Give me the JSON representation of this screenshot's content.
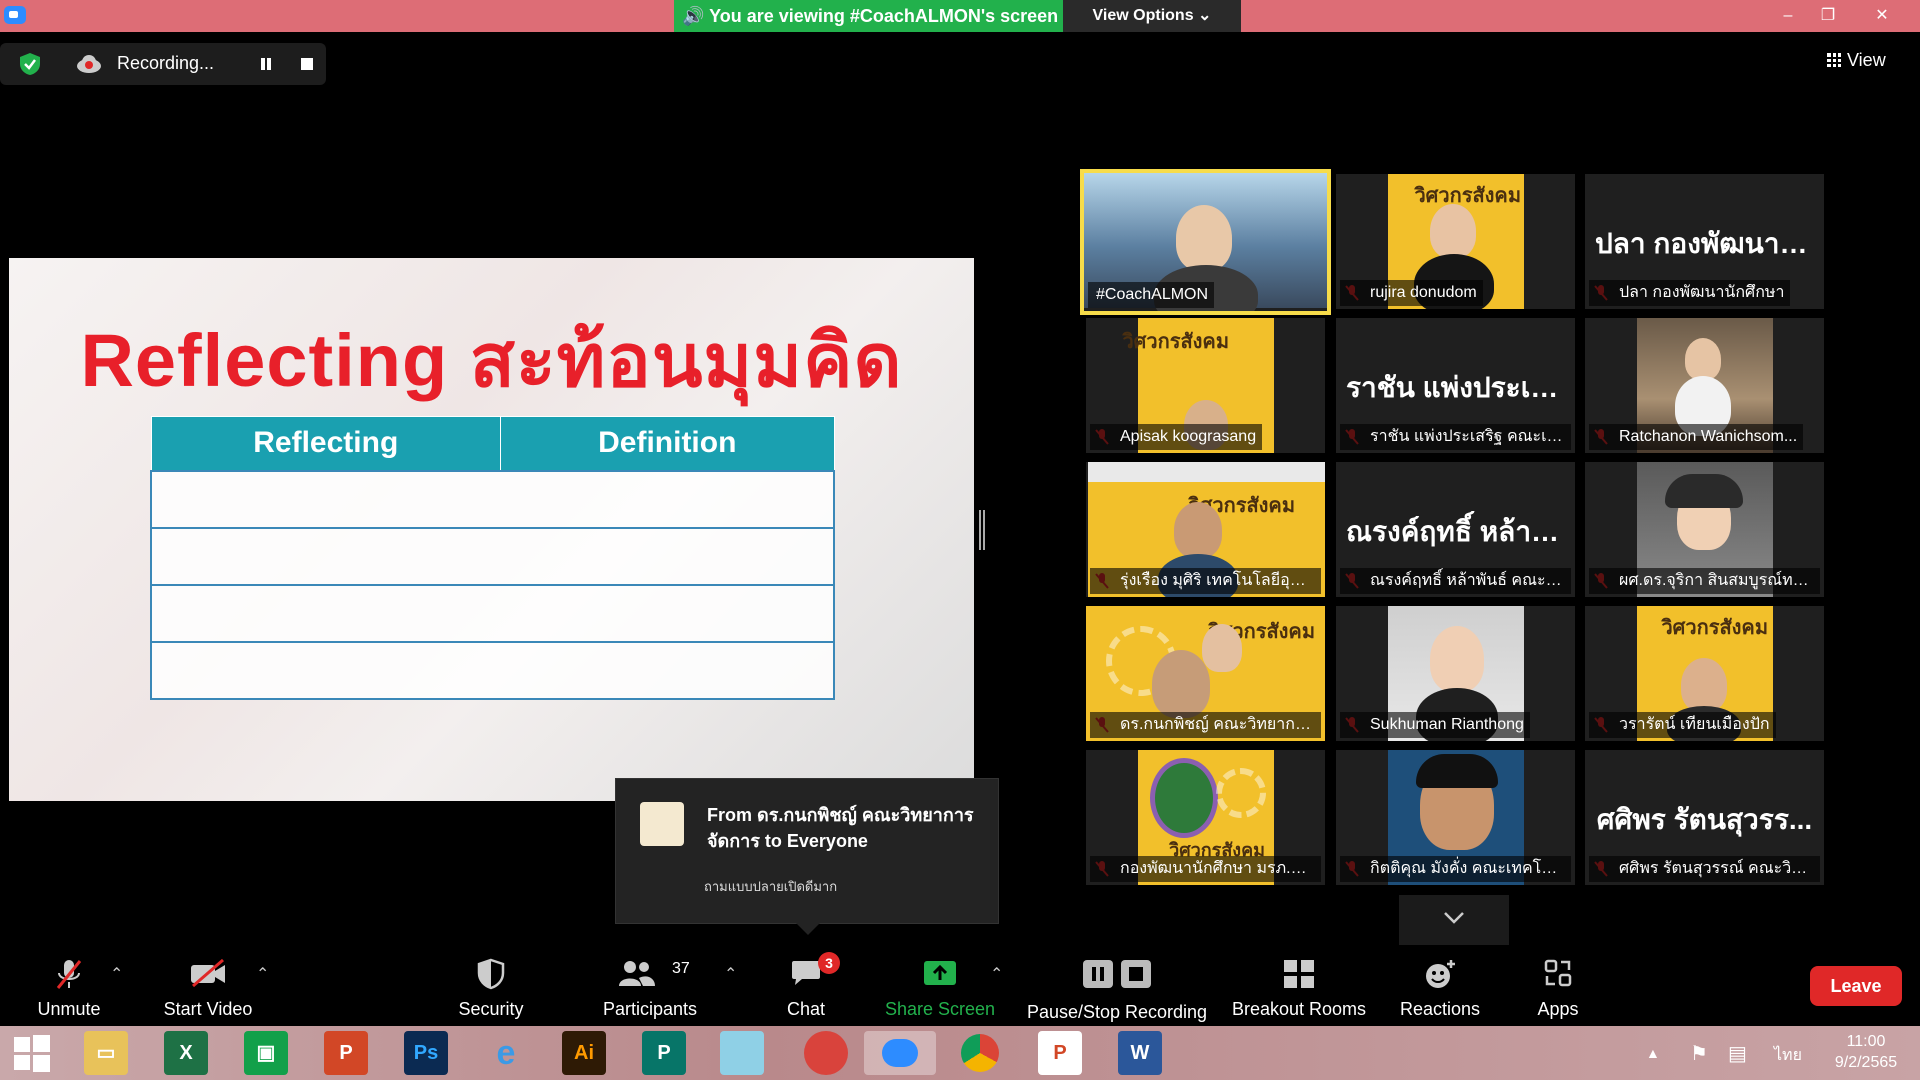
{
  "titlebar": {
    "banner_text": "You are viewing #CoachALMON's screen",
    "view_options": "View Options"
  },
  "recording": {
    "label": "Recording..."
  },
  "view_label": "View",
  "slide": {
    "title": "Reflecting สะท้อนมุมคิด",
    "col1": "Reflecting",
    "col2": "Definition"
  },
  "gallery": [
    {
      "caption": "#CoachALMON",
      "big": ""
    },
    {
      "caption": "rujira donudom",
      "big": ""
    },
    {
      "caption": "ปลา กองพัฒนานักศึกษา",
      "big": "ปลา กองพัฒนานั..."
    },
    {
      "caption": "Apisak koograsang",
      "big": ""
    },
    {
      "caption": "ราชัน แพ่งประเสริฐ คณะเทค...",
      "big": "ราชัน แพ่งประเส..."
    },
    {
      "caption": "Ratchanon Wanichsom...",
      "big": ""
    },
    {
      "caption": "รุ่งเรือง มุศิริ เทคโนโลยีอุตสา...",
      "big": ""
    },
    {
      "caption": "ณรงค์ฤทธิ์ หล้าพันธ์ คณะวิทย์",
      "big": "ณรงค์ฤทธิ์ หล้าพั..."
    },
    {
      "caption": "ผศ.ดร.จุริกา สินสมบูรณ์ทอง...",
      "big": ""
    },
    {
      "caption": "ดร.กนกพิชญ์ คณะวิทยาการ...",
      "big": ""
    },
    {
      "caption": "Sukhuman Rianthong",
      "big": ""
    },
    {
      "caption": "วรารัตน์ เทียนเมืองปัก",
      "big": ""
    },
    {
      "caption": "กองพัฒนานักศึกษา มรภ.พร...",
      "big": ""
    },
    {
      "caption": "กิตติคุณ มังคั่ง คณะเทคโนโล...",
      "big": ""
    },
    {
      "caption": "ศศิพร รัตนสุวรรณ์ คณะวิทย...",
      "big": "ศศิพร รัตนสุวรร..."
    }
  ],
  "tile_brand": "วิศวกรสังคม",
  "chat": {
    "from": "From ดร.กนกพิชญ์ คณะวิทยาการจัดการ to Everyone",
    "message": "ถามแบบปลายเปิดดีมาก"
  },
  "toolbar": {
    "unmute": "Unmute",
    "start_video": "Start Video",
    "security": "Security",
    "participants": "Participants",
    "participants_count": "37",
    "chat": "Chat",
    "chat_badge": "3",
    "share": "Share Screen",
    "pause_stop": "Pause/Stop Recording",
    "breakout": "Breakout Rooms",
    "reactions": "Reactions",
    "apps": "Apps",
    "leave": "Leave"
  },
  "taskbar": {
    "apps": [
      "windows-start",
      "file-explorer",
      "excel",
      "store",
      "powerpoint",
      "photoshop",
      "internet-explorer",
      "illustrator",
      "publisher",
      "notepad",
      "fotoscape",
      "zoom",
      "chrome",
      "powerpoint-viewer",
      "word"
    ],
    "lang": "ไทย",
    "time": "11:00",
    "date": "9/2/2565"
  },
  "colors": {
    "accent_green": "#22b14c",
    "leave_red": "#e02828",
    "slide_red": "#e8202a",
    "table_teal": "#1aa0b0"
  }
}
